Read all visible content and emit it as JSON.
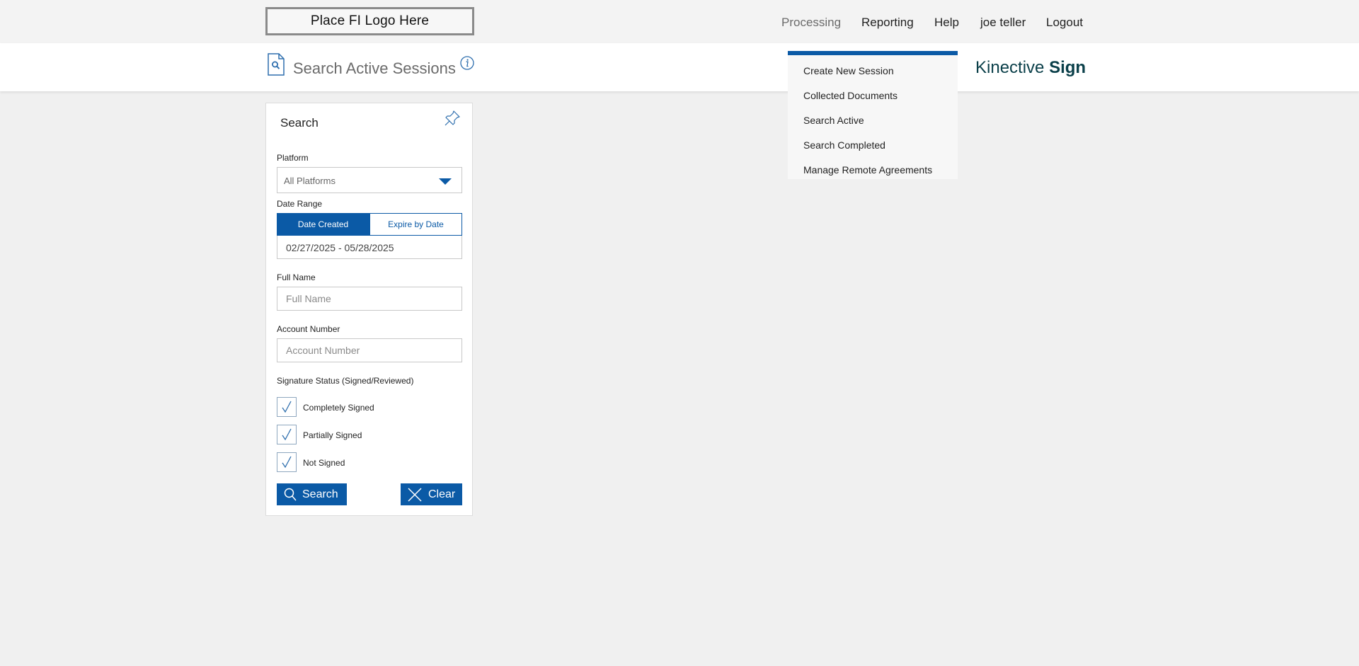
{
  "header": {
    "logo_text": "Place FI Logo Here",
    "nav": [
      "Processing",
      "Reporting",
      "Help",
      "joe teller",
      "Logout"
    ]
  },
  "subheader": {
    "title": "Search Active Sessions",
    "brand_light": "Kinective ",
    "brand_bold": "Sign"
  },
  "menu": {
    "items": [
      "Create New Session",
      "Collected Documents",
      "Search Active",
      "Search Completed",
      "Manage Remote Agreements"
    ]
  },
  "panel": {
    "title": "Search",
    "platform_label": "Platform",
    "platform_value": "All Platforms",
    "date_range_label": "Date Range",
    "date_created": "Date Created",
    "expire_by_date": "Expire by Date",
    "date_value": "02/27/2025 - 05/28/2025",
    "full_name_label": "Full Name",
    "full_name_placeholder": "Full Name",
    "account_label": "Account Number",
    "account_placeholder": "Account Number",
    "signature_label": "Signature Status (Signed/Reviewed)",
    "checkboxes": [
      "Completely Signed",
      "Partially Signed",
      "Not Signed"
    ],
    "search_button": "Search",
    "clear_button": "Clear"
  },
  "colors": {
    "accent": "#0b5aa6",
    "brand": "#0a3f49"
  }
}
